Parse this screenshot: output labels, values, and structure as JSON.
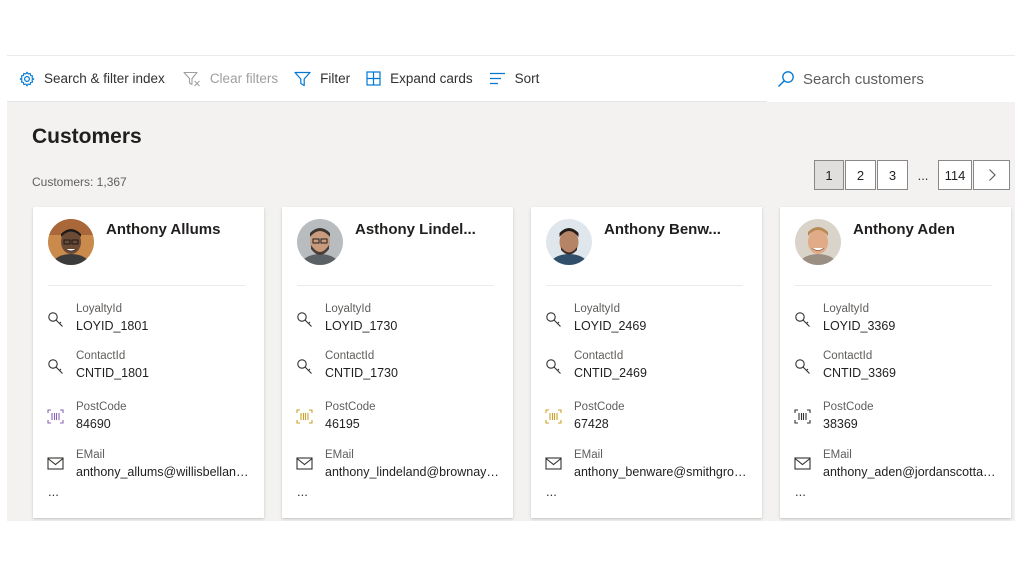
{
  "toolbar": {
    "search_filter_index": "Search & filter index",
    "clear_filters": "Clear filters",
    "filter": "Filter",
    "expand_cards": "Expand cards",
    "sort": "Sort",
    "search_placeholder": "Search customers"
  },
  "page": {
    "title": "Customers",
    "count_label": "Customers: 1,367"
  },
  "pager": {
    "pages": [
      "1",
      "2",
      "3"
    ],
    "ellipsis": "...",
    "last": "114",
    "active": "1"
  },
  "field_labels": {
    "loyalty": "LoyaltyId",
    "contact": "ContactId",
    "postcode": "PostCode",
    "email": "EMail",
    "more": "..."
  },
  "cards": [
    {
      "name": "Anthony Allums",
      "loyalty_id": "LOYID_1801",
      "contact_id": "CNTID_1801",
      "postcode": "84690",
      "email": "anthony_allums@willisbelland...",
      "avatar_bg": "#c98a4b"
    },
    {
      "name": "Asthony Lindel...",
      "loyalty_id": "LOYID_1730",
      "contact_id": "CNTID_1730",
      "postcode": "46195",
      "email": "anthony_lindeland@brownayer...",
      "avatar_bg": "#8a8d90"
    },
    {
      "name": "Anthony Benw...",
      "loyalty_id": "LOYID_2469",
      "contact_id": "CNTID_2469",
      "postcode": "67428",
      "email": "anthony_benware@smithgrou...",
      "avatar_bg": "#9fb3c4"
    },
    {
      "name": "Anthony Aden",
      "loyalty_id": "LOYID_3369",
      "contact_id": "CNTID_3369",
      "postcode": "38369",
      "email": "anthony_aden@jordanscottand...",
      "avatar_bg": "#c89a78"
    }
  ],
  "colors": {
    "accent": "#0078d4",
    "postcode_icon": "#8764b8",
    "page_bg": "#f3f2f1"
  }
}
